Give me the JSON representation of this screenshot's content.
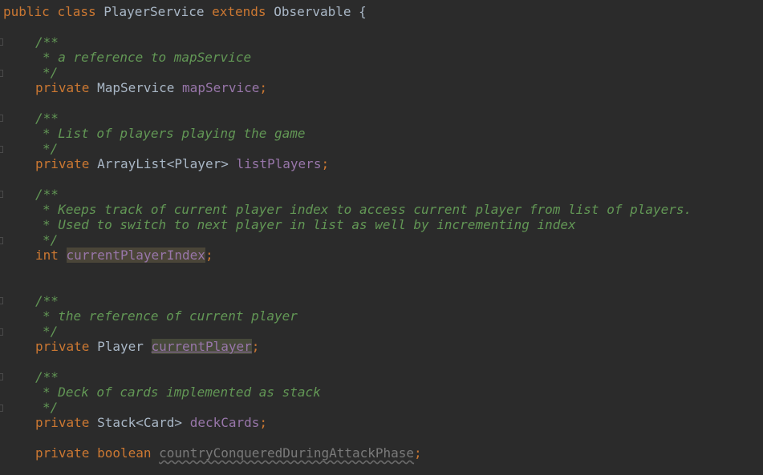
{
  "code": {
    "l1": {
      "kw1": "public",
      "kw2": "class",
      "name": "PlayerService",
      "kw3": "extends",
      "parent": "Observable",
      "brace": "{"
    },
    "c1": {
      "open": "/**",
      "text": "* a reference to mapService",
      "close": "*/"
    },
    "f1": {
      "mod": "private",
      "type": "MapService",
      "name": "mapService",
      "semi": ";"
    },
    "c2": {
      "open": "/**",
      "text": "* List of players playing the game",
      "close": "*/"
    },
    "f2": {
      "mod": "private",
      "type": "ArrayList<Player>",
      "name": "listPlayers",
      "semi": ";"
    },
    "c3": {
      "open": "/**",
      "text1": "* Keeps track of current player index to access current player from list of players.",
      "text2": "* Used to switch to next player in list as well by incrementing index",
      "close": "*/"
    },
    "f3": {
      "type": "int",
      "name": "currentPlayerIndex",
      "semi": ";"
    },
    "c4": {
      "open": "/**",
      "text": "* the reference of current player",
      "close": "*/"
    },
    "f4": {
      "mod": "private",
      "type": "Player",
      "name": "currentPlayer",
      "semi": ";"
    },
    "c5": {
      "open": "/**",
      "text": "* Deck of cards implemented as stack",
      "close": "*/"
    },
    "f5": {
      "mod": "private",
      "type": "Stack<Card>",
      "name": "deckCards",
      "semi": ";"
    },
    "f6": {
      "mod": "private",
      "type": "boolean",
      "name": "countryConqueredDuringAttackPhase",
      "semi": ";"
    }
  },
  "colors": {
    "background": "#2b2b2b",
    "keyword": "#cc7832",
    "field": "#9876aa",
    "comment": "#629755",
    "text": "#a9b7c6"
  }
}
